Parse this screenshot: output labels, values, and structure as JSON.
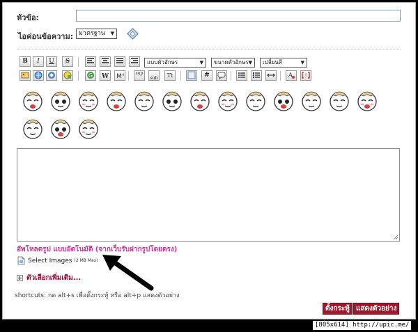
{
  "form": {
    "subject_label": "หัวข้อ:",
    "subject_value": "",
    "icon_label": "ไอค่อนข้อความ:",
    "icon_select": "มาตรฐาน"
  },
  "toolbar": {
    "font_family": "แบบตัวอักษร",
    "font_size": "ขนาดตัวอักษร",
    "font_color": "เปลี่ยนสี",
    "bold": "B",
    "italic": "I",
    "underline": "U",
    "strike": "S",
    "sup": "sup",
    "sub": "sub",
    "tt": "Tt",
    "hash": "#"
  },
  "editor": {
    "value": ""
  },
  "upload": {
    "title": "อัพโหลดรูป แบบอัตโนมัติ (จากเว็บรับฝากรูปโดยตรง)",
    "select_label": "Select Images",
    "max_label": "(2 MB Max)"
  },
  "more_options": "ตัวเลือกเพิ่มเติม...",
  "shortcuts": "shortcuts: กด alt+s เพื่อตั้งกระทู้ หรือ alt+p แสดงตัวอย่าง",
  "buttons": {
    "post": "ตั้งกระทู้",
    "preview": "แสดงตัวอย่าง"
  },
  "watermark": "[805x614] http://upic.me/",
  "colors": {
    "accent": "#cc3399",
    "button": "#a2172c",
    "more": "#990033"
  }
}
